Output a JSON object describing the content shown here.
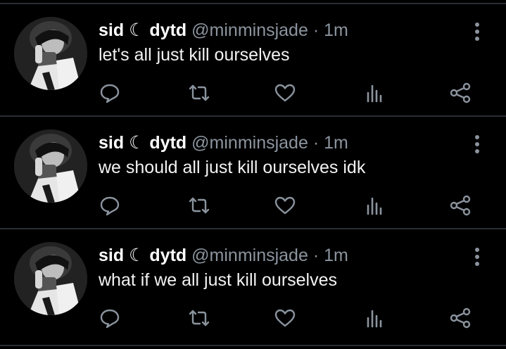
{
  "tweets": [
    {
      "name": "sid ☾ dytd",
      "handle": "@minminsjade",
      "separator": "·",
      "time": "1m",
      "text": "let's all just kill ourselves"
    },
    {
      "name": "sid ☾ dytd",
      "handle": "@minminsjade",
      "separator": "·",
      "time": "1m",
      "text": "we should all just kill ourselves idk"
    },
    {
      "name": "sid ☾ dytd",
      "handle": "@minminsjade",
      "separator": "·",
      "time": "1m",
      "text": "what if we all just kill ourselves"
    }
  ],
  "actions": [
    "reply-icon",
    "retweet-icon",
    "like-icon",
    "analytics-icon",
    "share-icon"
  ],
  "colors": {
    "background": "#000000",
    "muted": "#8b949e",
    "divider": "#2a2e33",
    "text": "#ffffff"
  }
}
